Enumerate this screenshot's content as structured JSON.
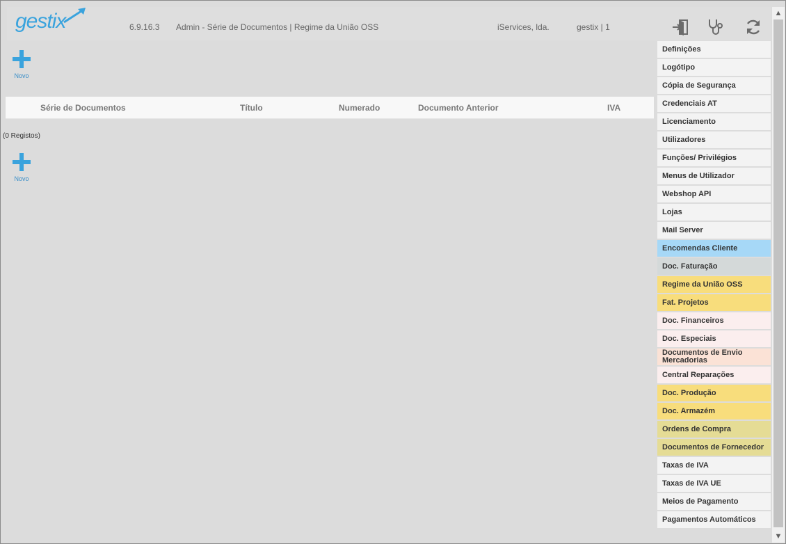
{
  "header": {
    "logo_text": "gestix",
    "version": "6.9.16.3",
    "title": "Admin - Série de Documentos | Regime da União OSS",
    "company": "iServices, lda.",
    "user": "gestix | 1",
    "icons": [
      "logout-icon",
      "stethoscope-icon",
      "refresh-icon"
    ]
  },
  "main": {
    "new_label": "Novo",
    "columns": [
      "Série de Documentos",
      "Título",
      "Numerado",
      "Documento Anterior",
      "IVA"
    ],
    "records_text": "(0 Registos)"
  },
  "sidebar": {
    "items": [
      {
        "label": "Definições",
        "color": "#f3f3f3"
      },
      {
        "label": "Logótipo",
        "color": "#f3f3f3"
      },
      {
        "label": "Cópia de Segurança",
        "color": "#f3f3f3"
      },
      {
        "label": "Credenciais AT",
        "color": "#f3f3f3"
      },
      {
        "label": "Licenciamento",
        "color": "#f3f3f3"
      },
      {
        "label": "Utilizadores",
        "color": "#f3f3f3"
      },
      {
        "label": "Funções/ Privilégios",
        "color": "#f3f3f3"
      },
      {
        "label": "Menus de Utilizador",
        "color": "#f3f3f3"
      },
      {
        "label": "Webshop API",
        "color": "#f3f3f3"
      },
      {
        "label": "Lojas",
        "color": "#f3f3f3"
      },
      {
        "label": "Mail Server",
        "color": "#f3f3f3"
      },
      {
        "label": "Encomendas Cliente",
        "color": "#a6d8f7"
      },
      {
        "label": "Doc. Faturação",
        "color": "#d4d9d9"
      },
      {
        "label": "Regime da União OSS",
        "color": "#f8dd7c"
      },
      {
        "label": "Fat. Projetos",
        "color": "#f8dd7c"
      },
      {
        "label": "Doc. Financeiros",
        "color": "#fbeeee"
      },
      {
        "label": "Doc. Especiais",
        "color": "#fbeeee"
      },
      {
        "label": "Documentos de Envio Mercadorias",
        "color": "#fbe2d6"
      },
      {
        "label": "Central Reparações",
        "color": "#fbeeee"
      },
      {
        "label": "Doc. Produção",
        "color": "#f8dd7c"
      },
      {
        "label": "Doc. Armazém",
        "color": "#f8dd7c"
      },
      {
        "label": "Ordens de Compra",
        "color": "#e5dc95"
      },
      {
        "label": "Documentos de Fornecedor",
        "color": "#e5dc95"
      },
      {
        "label": "Taxas de IVA",
        "color": "#f3f3f3"
      },
      {
        "label": "Taxas de IVA UE",
        "color": "#f3f3f3"
      },
      {
        "label": "Meios de Pagamento",
        "color": "#f3f3f3"
      },
      {
        "label": "Pagamentos Automáticos",
        "color": "#f3f3f3"
      }
    ]
  }
}
